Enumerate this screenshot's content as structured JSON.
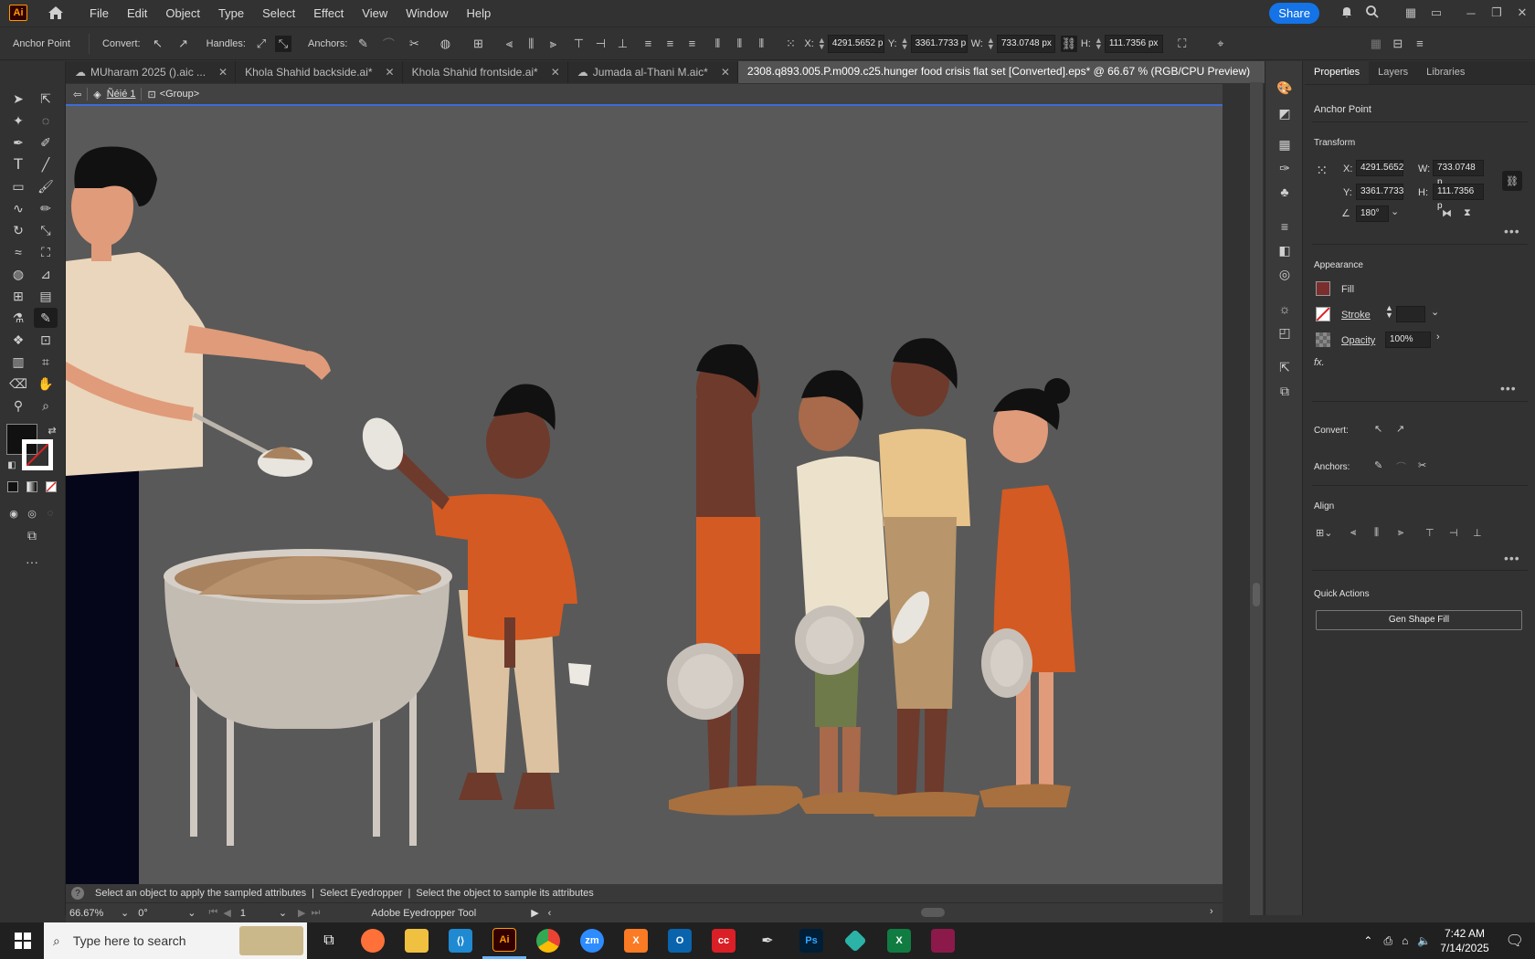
{
  "menubar": {
    "app_icon": "Ai",
    "menus": [
      "File",
      "Edit",
      "Object",
      "Type",
      "Select",
      "Effect",
      "View",
      "Window",
      "Help"
    ],
    "share_label": "Share"
  },
  "control_bar": {
    "mode_label": "Anchor Point",
    "convert_label": "Convert:",
    "handles_label": "Handles:",
    "anchors_label": "Anchors:",
    "x_label": "X:",
    "x_value": "4291.5652 p",
    "y_label": "Y:",
    "y_value": "3361.7733 p",
    "w_label": "W:",
    "w_value": "733.0748 px",
    "h_label": "H:",
    "h_value": "111.7356 px"
  },
  "tabs": [
    {
      "label": "MUharam 2025 ().aic ...",
      "cloud": true
    },
    {
      "label": "Khola Shahid backside.ai*",
      "cloud": false
    },
    {
      "label": "Khola Shahid frontside.ai*",
      "cloud": false
    },
    {
      "label": "Jumada al-Thani M.aic*",
      "cloud": true
    },
    {
      "label": "2308.q893.005.P.m009.c25.hunger food crisis flat set [Converted].eps* @ 66.67 % (RGB/CPU Preview)",
      "cloud": false
    }
  ],
  "breadcrumb": {
    "layer": "Ñéié 1",
    "group": "<Group>"
  },
  "status": {
    "hint": "Select an object to apply the sampled attributes",
    "hint2": "Select Eyedropper",
    "hint3": "Select the object to sample its attributes"
  },
  "bottom": {
    "zoom": "66.67%",
    "rotation": "0°",
    "artboard": "1",
    "tool_name": "Adobe Eyedropper Tool"
  },
  "properties": {
    "tabs": [
      "Properties",
      "Layers",
      "Libraries"
    ],
    "context": "Anchor Point",
    "transform_title": "Transform",
    "x_label": "X:",
    "x_value": "4291.5652",
    "y_label": "Y:",
    "y_value": "3361.7733",
    "w_label": "W:",
    "w_value": "733.0748 p",
    "h_label": "H:",
    "h_value": "111.7356 p",
    "angle_value": "180°",
    "appearance_title": "Appearance",
    "fill_label": "Fill",
    "stroke_label": "Stroke",
    "opacity_label": "Opacity",
    "opacity_value": "100%",
    "fx_label": "fx.",
    "convert_label": "Convert:",
    "anchors_label": "Anchors:",
    "align_title": "Align",
    "quick_actions_title": "Quick Actions",
    "gen_shape_fill": "Gen Shape Fill"
  },
  "taskbar": {
    "search_placeholder": "Type here to search",
    "time": "7:42 AM",
    "date": "7/14/2025"
  },
  "colors": {
    "canvas_bg": "#595959",
    "accent": "#1473e6",
    "orange_shirt": "#d35a22",
    "skin_dark": "#6e3a2c"
  }
}
